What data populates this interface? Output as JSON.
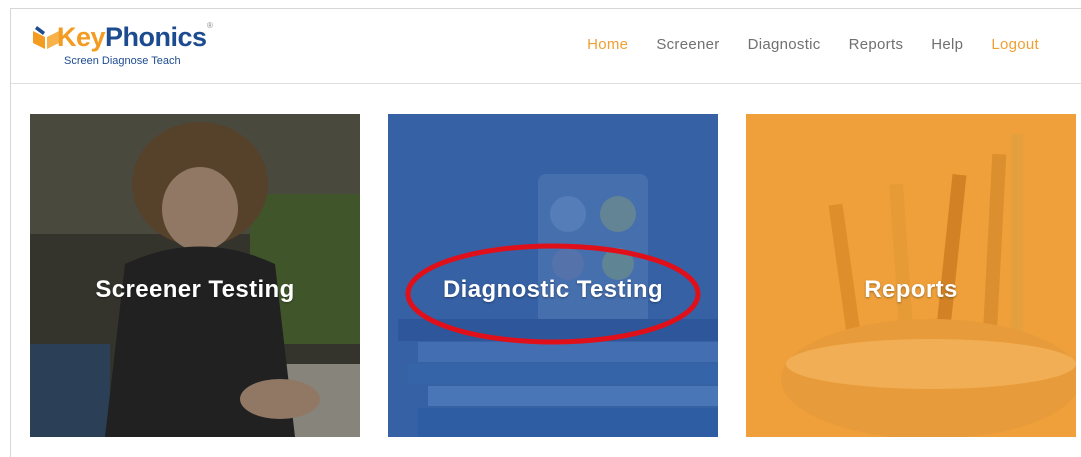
{
  "brand": {
    "name_part1": "Key",
    "name_part2": "Phonics",
    "tagline": "Screen Diagnose Teach",
    "registered_mark": "®",
    "logo_colors": {
      "orange": "#f39c21",
      "blue": "#1d4b8f"
    }
  },
  "nav": {
    "items": [
      {
        "label": "Home",
        "accent": true
      },
      {
        "label": "Screener",
        "accent": false
      },
      {
        "label": "Diagnostic",
        "accent": false
      },
      {
        "label": "Reports",
        "accent": false
      },
      {
        "label": "Help",
        "accent": false
      },
      {
        "label": "Logout",
        "accent": true
      }
    ],
    "accent_color": "#f0a033",
    "text_color": "#707070"
  },
  "tiles": [
    {
      "label": "Screener Testing",
      "icon": "child-writing-photo",
      "overlay_color": "#2b2b2b"
    },
    {
      "label": "Diagnostic Testing",
      "icon": "books-and-cup-photo",
      "overlay_color": "#2f5da3",
      "highlighted": true,
      "highlight_color": "#e0101a"
    },
    {
      "label": "Reports",
      "icon": "pencils-in-cup-photo",
      "overlay_color": "#f0a13a"
    }
  ]
}
